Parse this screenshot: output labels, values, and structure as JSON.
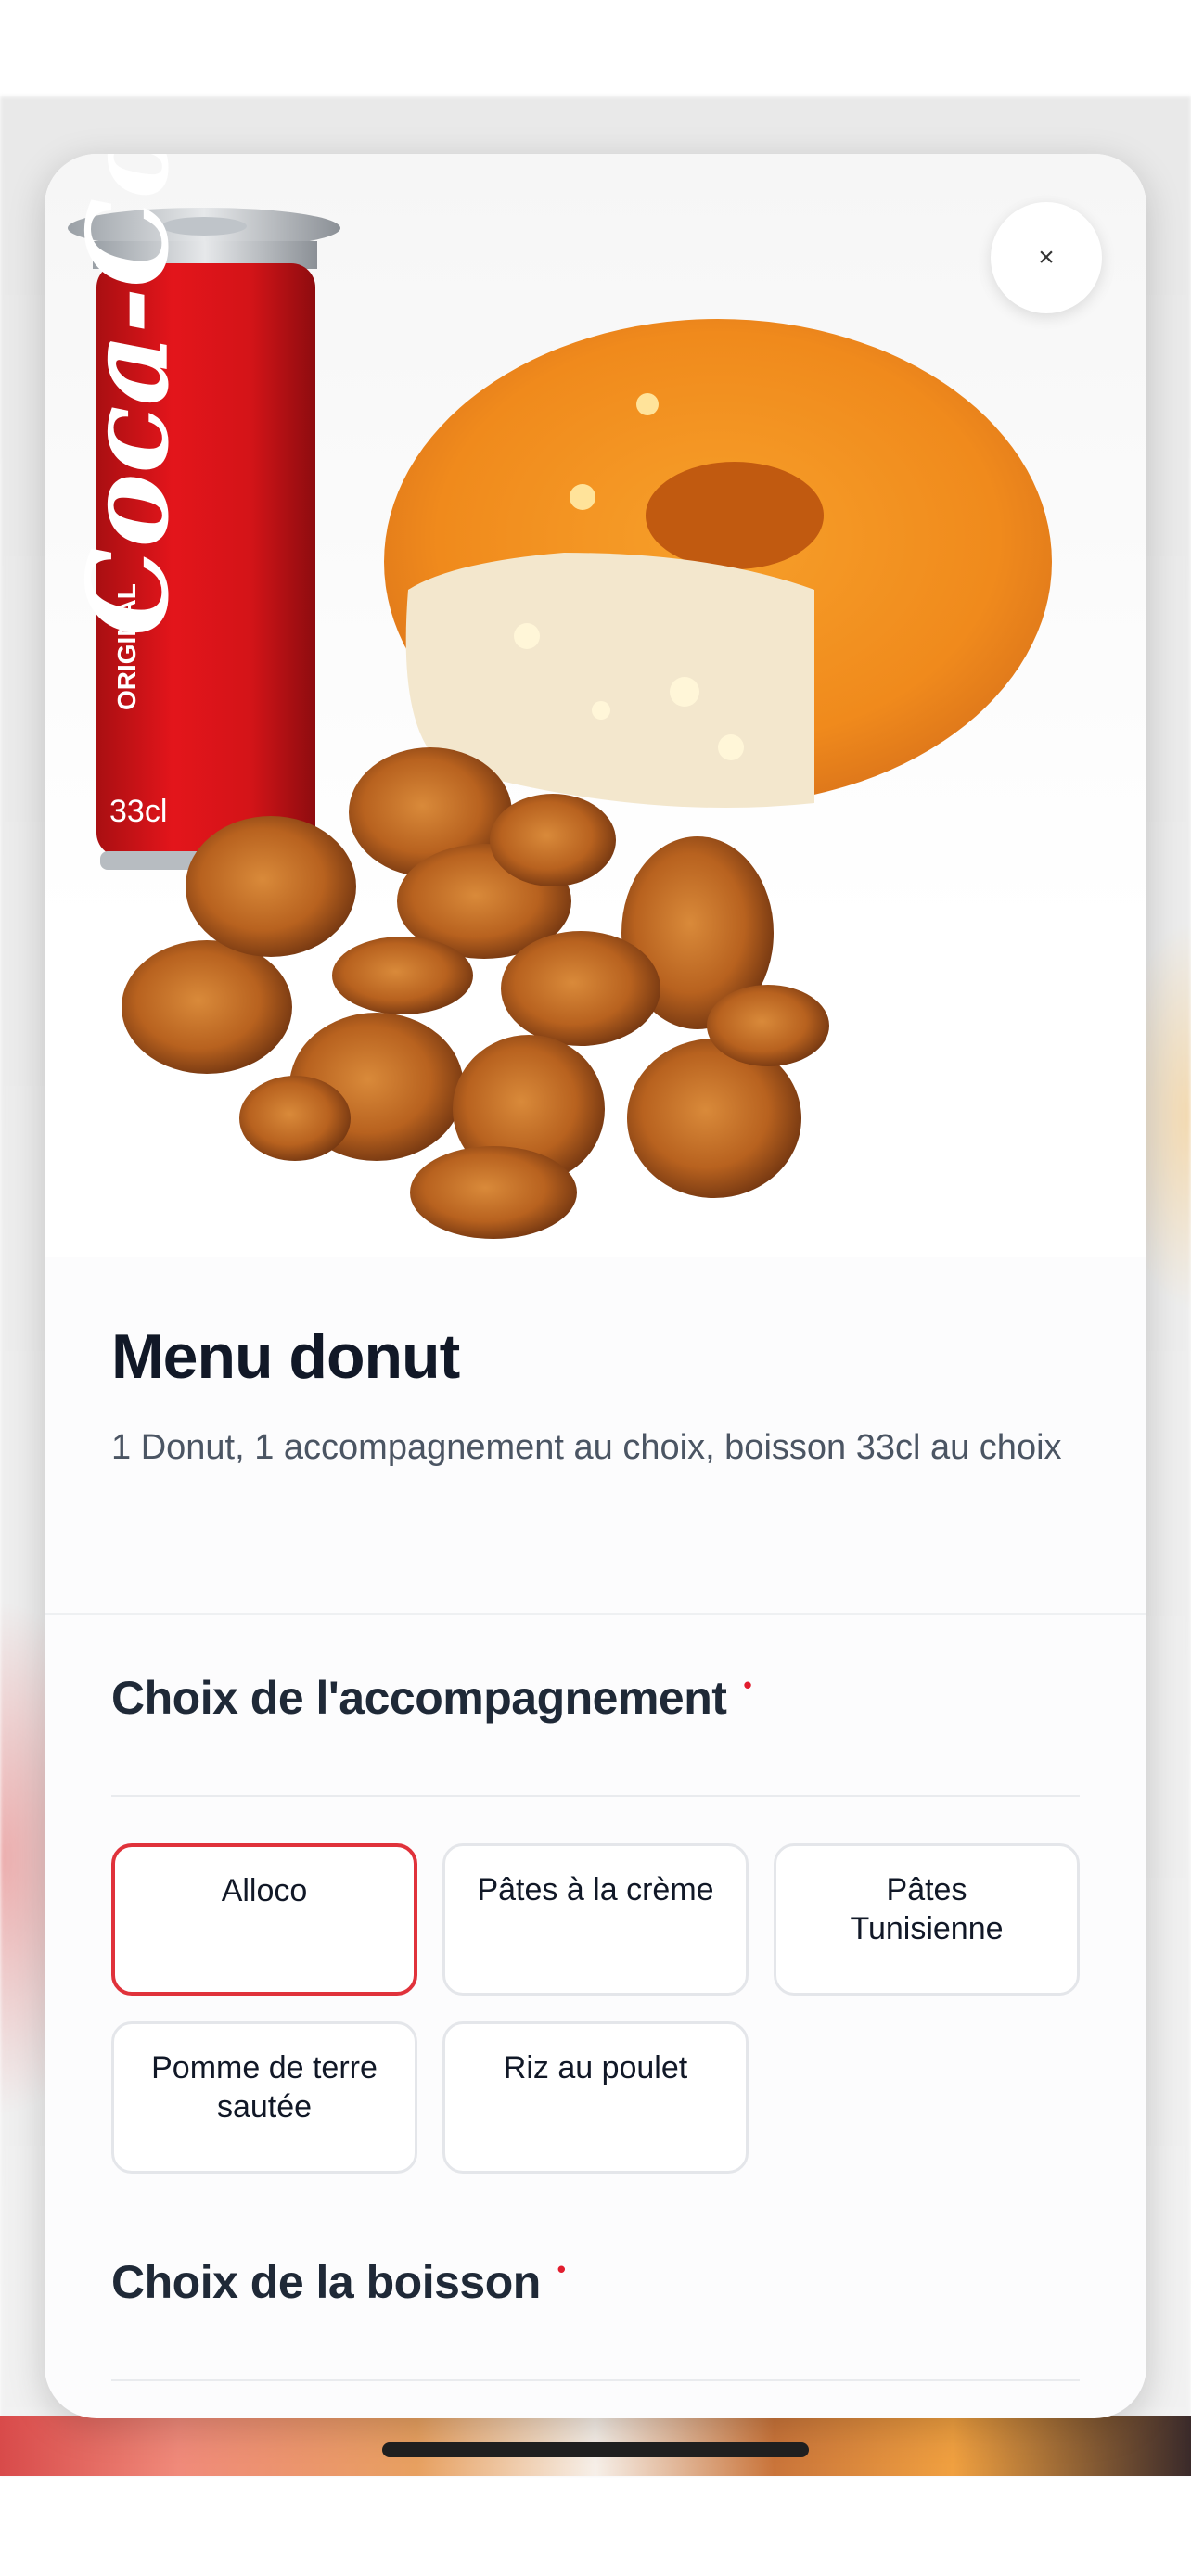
{
  "menu": {
    "title": "Menu donut",
    "description": "1 Donut, 1 accompagnement au choix, boisson 33cl au choix"
  },
  "sections": [
    {
      "title": "Choix de l'accompagnement",
      "required_marker": "•",
      "options": [
        "Alloco",
        "Pâtes à la crème",
        "Pâtes Tunisienne",
        "Pomme de terre sautée",
        "Riz au poulet"
      ],
      "selected": "Alloco"
    },
    {
      "title": "Choix de la boisson",
      "required_marker": "•"
    }
  ],
  "close": {
    "icon": "close-icon",
    "glyph": "×"
  },
  "hero_image": {
    "can_brand": "Coca-Cola",
    "can_top_text": "ORIGINAL",
    "can_volume": "33cl"
  },
  "colors": {
    "accent": "#e0323b",
    "title": "#111827",
    "text_secondary": "#4b5563"
  }
}
